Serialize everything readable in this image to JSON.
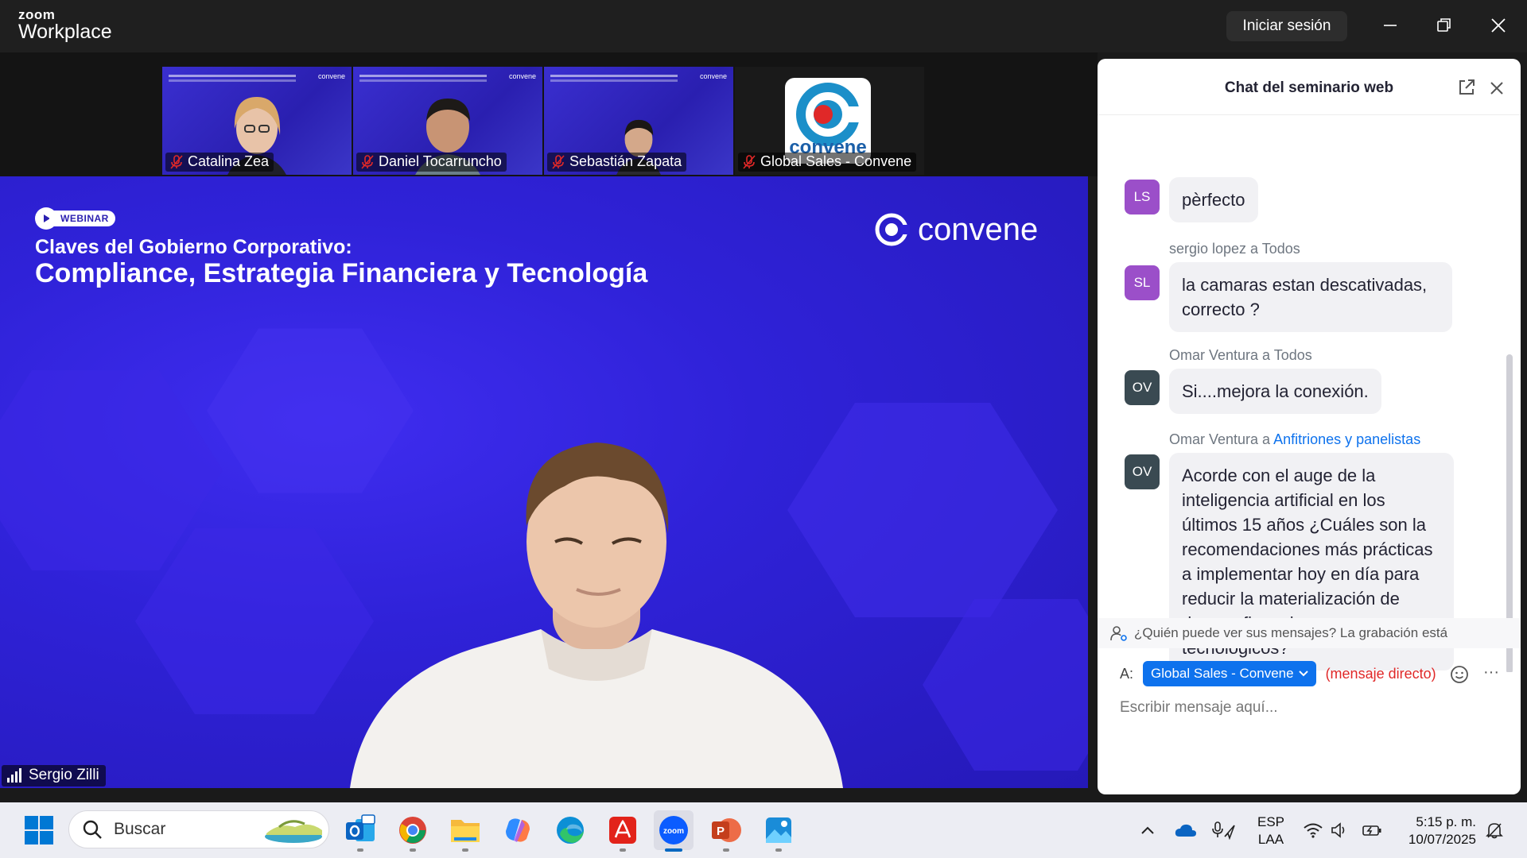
{
  "titlebar": {
    "brand_small": "zoom",
    "brand_large": "Workplace",
    "signin_label": "Iniciar sesión"
  },
  "thumbnails": [
    {
      "name": "Catalina Zea",
      "brand": "convene"
    },
    {
      "name": "Daniel Tocarruncho",
      "brand": "convene"
    },
    {
      "name": "Sebastián Zapata",
      "brand": "convene"
    },
    {
      "name": "Global Sales - Convene",
      "logo_text": "convene"
    }
  ],
  "main_video": {
    "badge": "WEBINAR",
    "title_line1": "Claves del Gobierno Corporativo:",
    "title_line2": "Compliance, Estrategia Financiera y Tecnología",
    "brand": "convene",
    "speaker": "Sergio Zilli"
  },
  "chat": {
    "title": "Chat del seminario web",
    "messages": [
      {
        "initials": "LS",
        "avatar_color": "#9b4fc9",
        "sender": "",
        "sender_to": "",
        "text": "pèrfecto"
      },
      {
        "initials": "SL",
        "avatar_color": "#9b4fc9",
        "sender": "sergio lopez a Todos",
        "sender_to": "",
        "text": "la camaras estan descativadas, correcto ?"
      },
      {
        "initials": "OV",
        "avatar_color": "#3a4a52",
        "sender": "Omar Ventura a Todos",
        "sender_to": "",
        "text": "Si....mejora la conexión."
      },
      {
        "initials": "OV",
        "avatar_color": "#3a4a52",
        "sender": "Omar Ventura a",
        "sender_to": "Anfitriones y panelistas",
        "text": "Acorde con el auge de la inteligencia artificial en los últimos 15 años ¿Cuáles son la recomendaciones más prácticas a implementar hoy en día para reducir la materialización de riesgos financieros y tecnológicos?"
      }
    ],
    "notice": "¿Quién puede ver sus mensajes? La grabación está",
    "to_label": "A:",
    "recipient": "Global Sales - Convene",
    "direct_label": "(mensaje directo)",
    "more_label": "···",
    "input_placeholder": "Escribir mensaje aquí..."
  },
  "taskbar": {
    "search_placeholder": "Buscar",
    "apps": [
      "outlook-icon",
      "chrome-icon",
      "file-explorer-icon",
      "copilot-icon",
      "edge-icon",
      "acrobat-icon",
      "zoom-icon",
      "powerpoint-icon",
      "photos-icon"
    ],
    "lang_line1": "ESP",
    "lang_line2": "LAA",
    "time": "5:15 p. m.",
    "date": "10/07/2025"
  },
  "colors": {
    "accent": "#0e72ed",
    "direct": "#e02828",
    "slide_bg": "#2f22d8"
  }
}
